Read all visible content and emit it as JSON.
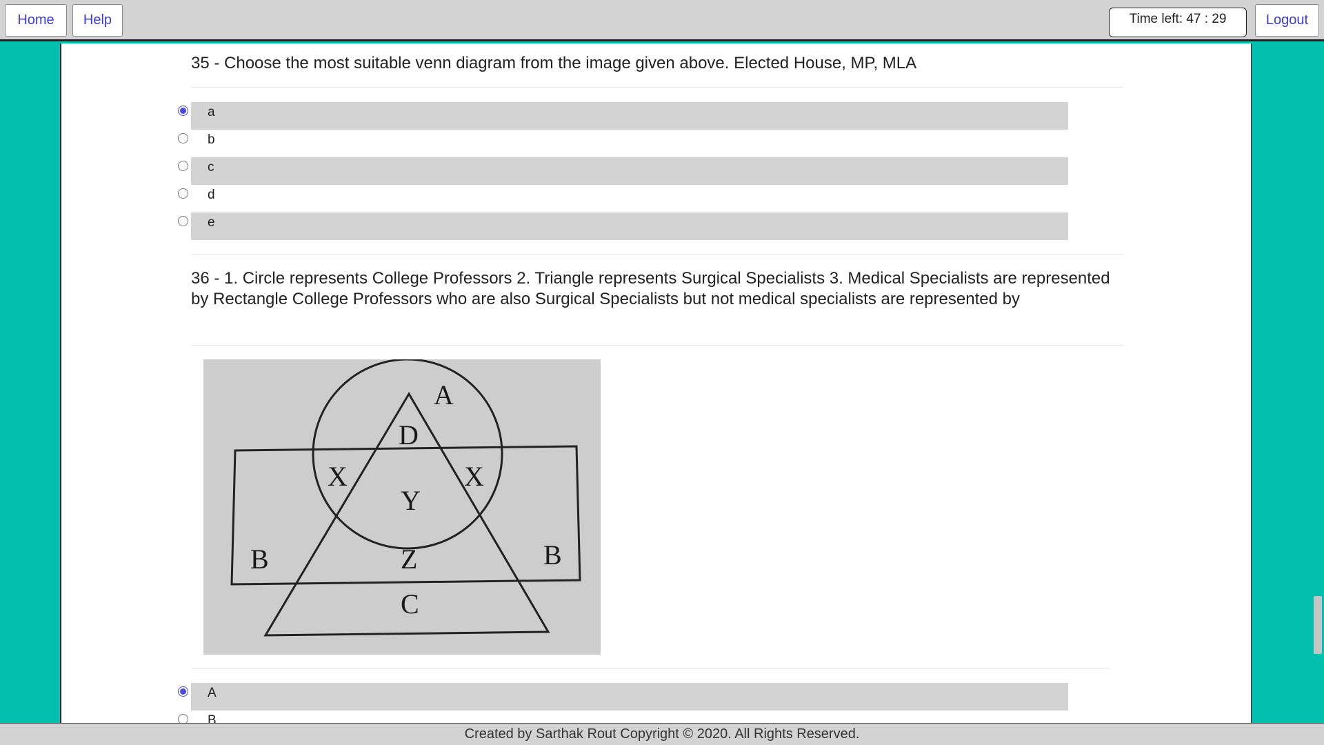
{
  "topbar": {
    "home_label": "Home",
    "help_label": "Help",
    "timer_text": "Time left: 47 : 29",
    "logout_label": "Logout"
  },
  "questions": [
    {
      "text": "35 - Choose the most suitable venn diagram from the image given above. Elected House, MP, MLA",
      "selected": "a",
      "options": [
        "a",
        "b",
        "c",
        "d",
        "e"
      ]
    },
    {
      "text": "36 - 1. Circle represents College Professors 2. Triangle represents Surgical Specialists 3. Medical Specialists are represented by Rectangle College Professors who are also Surgical Specialists but not medical specialists are represented by",
      "image_labels": [
        "A",
        "D",
        "X",
        "X",
        "Y",
        "B",
        "Z",
        "B",
        "C"
      ],
      "selected": "A",
      "options": [
        "A",
        "B"
      ]
    }
  ],
  "footer": {
    "text": "Created by Sarthak Rout Copyright © 2020. All Rights Reserved."
  }
}
